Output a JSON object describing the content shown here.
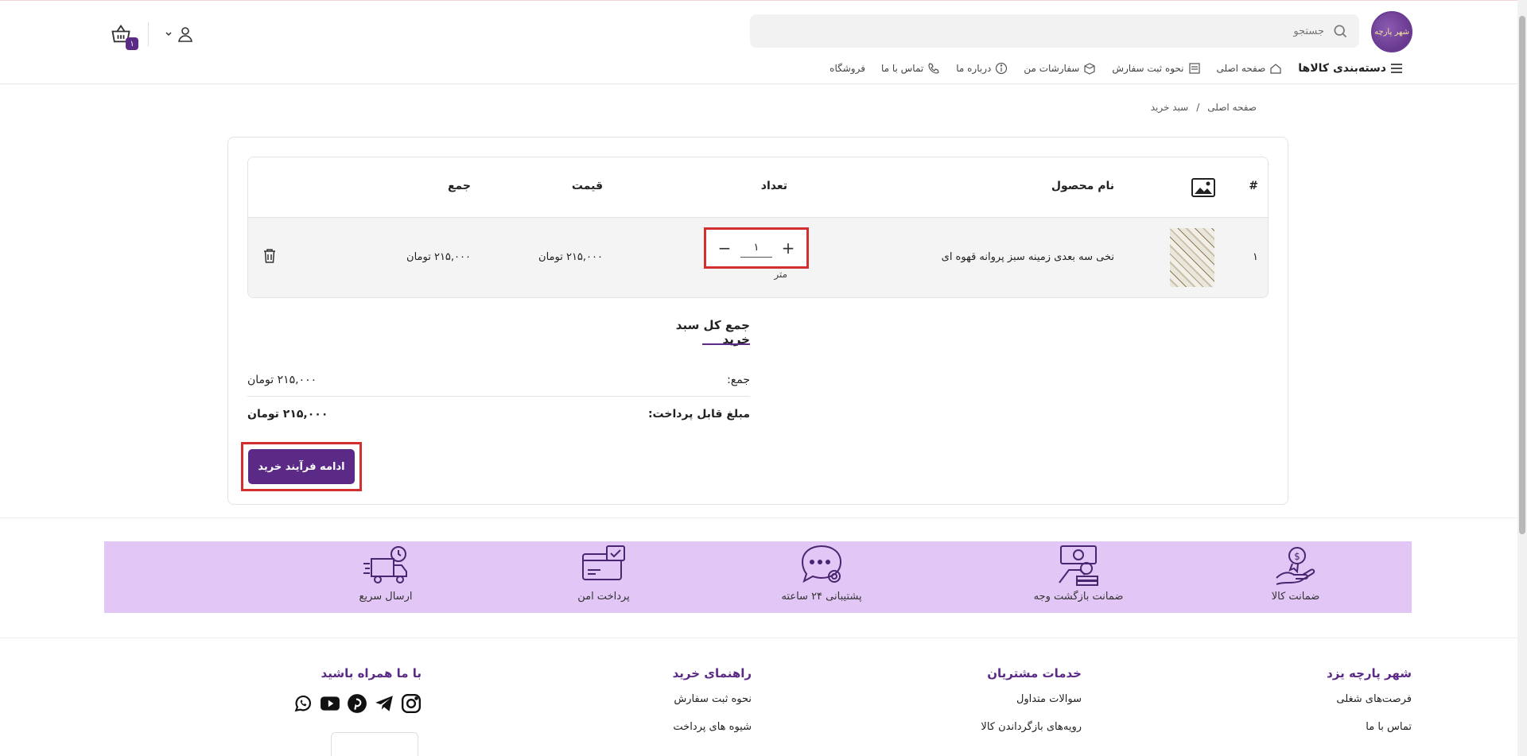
{
  "header": {
    "logo_text": "شهر پارچه",
    "search_placeholder": "جستجو",
    "cart_count": "۱"
  },
  "nav": [
    {
      "label": "دسته‌بندی کالاها",
      "icon": "menu-icon"
    },
    {
      "label": "صفحه اصلی",
      "icon": "home-icon"
    },
    {
      "label": "نحوه ثبت سفارش",
      "icon": "document-icon"
    },
    {
      "label": "سفارشات من",
      "icon": "box-icon"
    },
    {
      "label": "درباره ما",
      "icon": "info-icon"
    },
    {
      "label": "تماس با ما",
      "icon": "phone-icon"
    },
    {
      "label": "فروشگاه",
      "icon": ""
    }
  ],
  "breadcrumb": {
    "home": "صفحه اصلی",
    "separator": "/",
    "current": "سبد خرید"
  },
  "table": {
    "headers": {
      "index": "#",
      "name": "نام محصول",
      "qty": "تعداد",
      "price": "قیمت",
      "total": "جمع"
    },
    "rows": [
      {
        "index": "۱",
        "name": "نخی سه بعدی زمینه سبز پروانه قهوه ای",
        "qty": "۱",
        "unit": "متر",
        "price": "۲۱۵,۰۰۰ تومان",
        "total": "۲۱۵,۰۰۰ تومان"
      }
    ]
  },
  "totals": {
    "title": "جمع کل سبد خرید",
    "subtotal_label": "جمع:",
    "subtotal_value": "۲۱۵,۰۰۰ تومان",
    "payable_label": "مبلغ قابل پرداخت:",
    "payable_value": "۲۱۵,۰۰۰ تومان",
    "checkout_button": "ادامه فرآیند خرید"
  },
  "features": [
    {
      "label": "ضمانت کالا",
      "icon": "warranty-icon"
    },
    {
      "label": "ضمانت بازگشت وجه",
      "icon": "money-back-icon"
    },
    {
      "label": "پشتیبانی ۲۴ ساعته",
      "icon": "support-icon"
    },
    {
      "label": "پرداخت امن",
      "icon": "secure-payment-icon"
    },
    {
      "label": "ارسال سریع",
      "icon": "fast-delivery-icon"
    }
  ],
  "footer": {
    "col1": {
      "title": "شهر پارچه یزد",
      "links": [
        "فرصت‌های شغلی",
        "تماس با ما"
      ]
    },
    "col2": {
      "title": "خدمات مشتریان",
      "links": [
        "سوالات متداول",
        "رویه‌های بازگرداندن کالا"
      ]
    },
    "col3": {
      "title": "راهنمای خرید",
      "links": [
        "نحوه ثبت سفارش",
        "شیوه های پرداخت"
      ]
    },
    "col4": {
      "title": "با ما همراه باشید"
    }
  },
  "colors": {
    "brand": "#5b2a86",
    "highlight": "#d32f2f",
    "features_bg": "#e2c6f5"
  }
}
